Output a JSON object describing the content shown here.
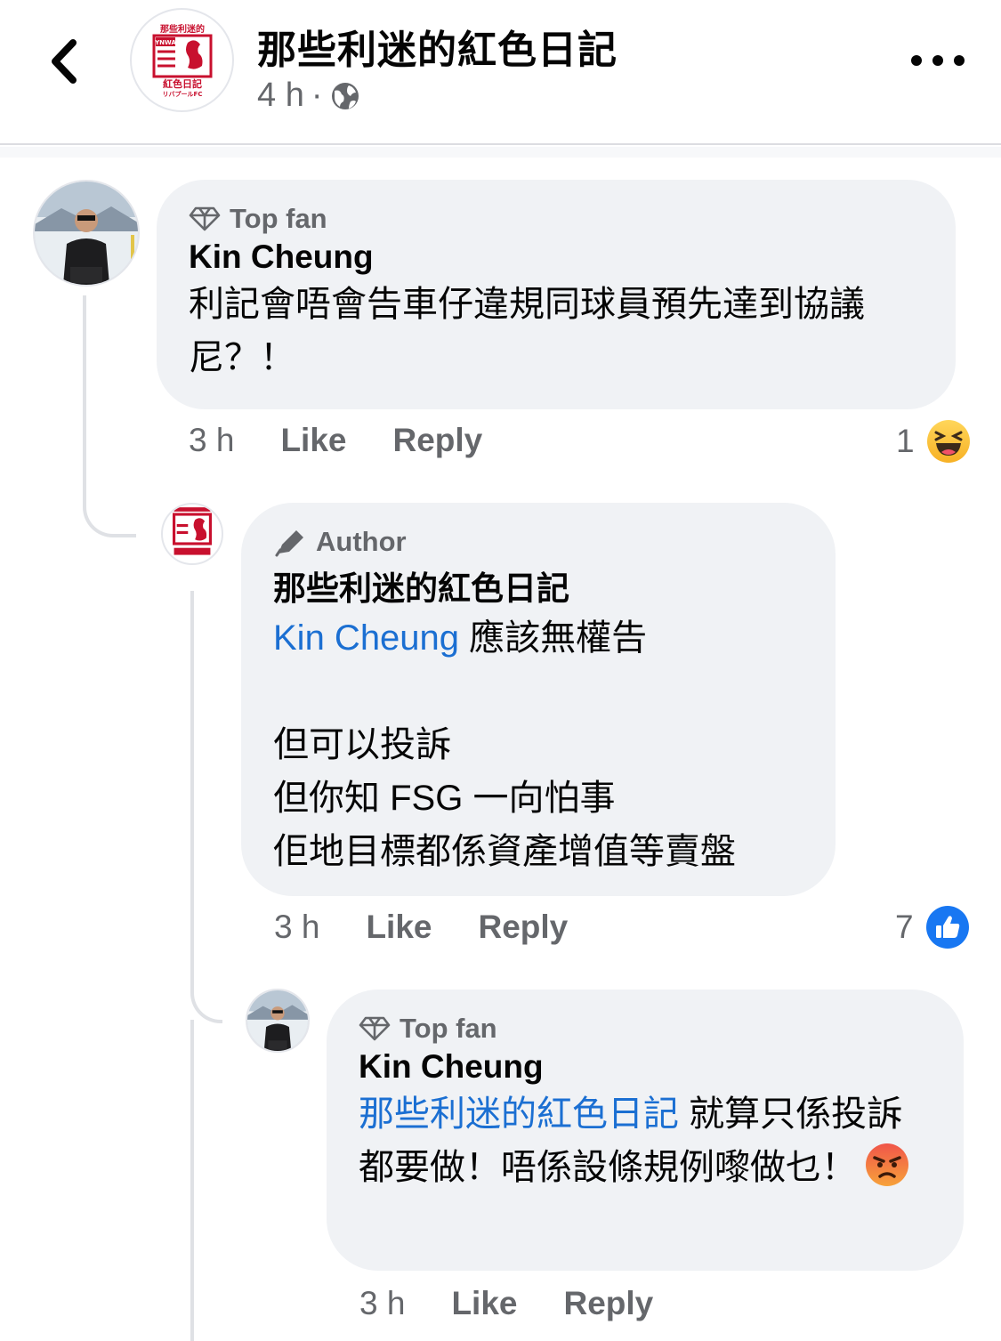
{
  "header": {
    "page_name": "那些利迷的紅色日記",
    "time": "4 h",
    "separator": "·",
    "logo_text": [
      "那些利迷的",
      "YNWA",
      "紅色日記",
      "リバプールFC"
    ]
  },
  "comments": [
    {
      "badge": "Top fan",
      "author": "Kin Cheung",
      "mention": "",
      "text": "利記會唔會告車仔違規同球員預先達到協議尼？！",
      "time": "3 h",
      "like": "Like",
      "reply": "Reply",
      "reaction_count": "1",
      "reaction_icon": "laughing-emoji"
    },
    {
      "badge": "Author",
      "author": "那些利迷的紅色日記",
      "mention": "Kin Cheung",
      "text_after_mention": " 應該無權告",
      "text": "\n\n但可以投訴\n但你知 FSG 一向怕事\n佢地目標都係資產增值等賣盤",
      "time": "3 h",
      "like": "Like",
      "reply": "Reply",
      "reaction_count": "7",
      "reaction_icon": "like-thumb"
    },
    {
      "badge": "Top fan",
      "author": "Kin Cheung",
      "mention": "那些利迷的紅色日記",
      "text_after_mention": " 就算只係投訴都要做！唔係設條規例嚟做乜！",
      "emoji": "angry-emoji",
      "time": "3 h",
      "like": "Like",
      "reply": "Reply"
    }
  ],
  "colors": {
    "bubble": "#f0f2f5",
    "secondary_text": "#65676b",
    "mention": "#1b6fd2",
    "like_blue": "#1877f2",
    "logo_red": "#c8102e"
  }
}
